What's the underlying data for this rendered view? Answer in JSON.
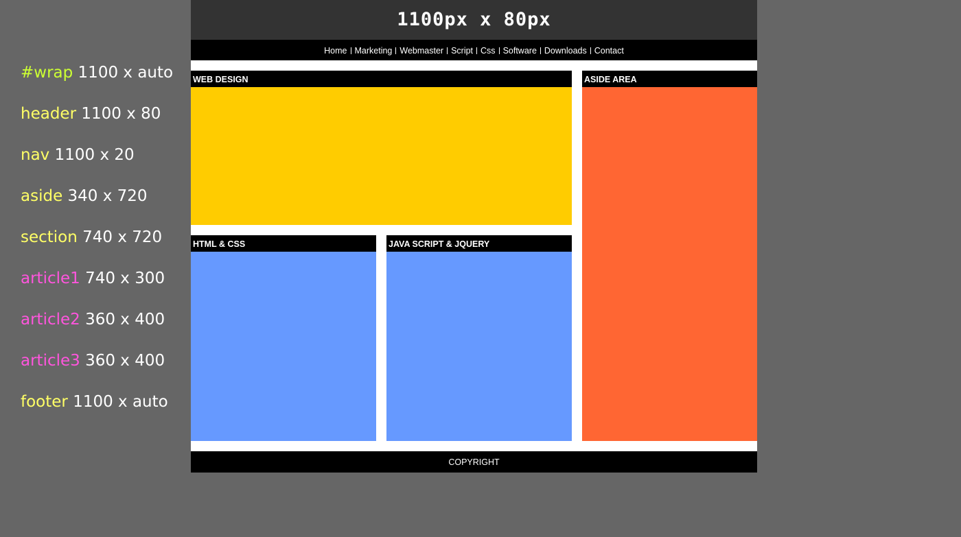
{
  "legend": [
    {
      "key": "#wrap",
      "dims": "1100 x auto"
    },
    {
      "key": "header",
      "dims": "1100 x 80"
    },
    {
      "key": "nav",
      "dims": "1100 x 20"
    },
    {
      "key": "aside",
      "dims": "340 x 720"
    },
    {
      "key": "section",
      "dims": "740 x 720"
    },
    {
      "key": "article1",
      "dims": "740 x 300"
    },
    {
      "key": "article2",
      "dims": "360 x 400"
    },
    {
      "key": "article3",
      "dims": "360 x 400"
    },
    {
      "key": "footer",
      "dims": "1100 x auto"
    }
  ],
  "header": {
    "title": "1100px x 80px"
  },
  "nav": {
    "items": [
      "Home",
      "Marketing",
      "Webmaster",
      "Script",
      "Css",
      "Software",
      "Downloads",
      "Contact"
    ]
  },
  "article1": {
    "title": "WEB DESIGN"
  },
  "article2": {
    "title": "HTML & CSS"
  },
  "article3": {
    "title": "JAVA SCRIPT & JQUERY"
  },
  "aside": {
    "title": "ASIDE AREA"
  },
  "footer": {
    "text": "COPYRIGHT"
  },
  "colors": {
    "page_background": "#666666",
    "header_background": "#333333",
    "nav_background": "#000000",
    "article1_fill": "#ffcc00",
    "article_fill": "#6699ff",
    "aside_fill": "#ff6633",
    "legend_key": "#ffff66",
    "legend_key_wrap": "#ccff33",
    "legend_key_article": "#ff55dd"
  }
}
